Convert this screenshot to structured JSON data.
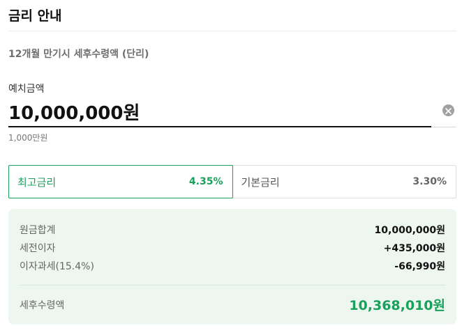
{
  "header": {
    "title": "금리 안내",
    "subtitle": "12개월 만기시 세후수령액 (단리)"
  },
  "deposit": {
    "label": "예치금액",
    "value": "10,000,000원",
    "helper": "1,000만원",
    "clear_icon": "clear-icon"
  },
  "rates": [
    {
      "name": "최고금리",
      "value": "4.35%",
      "selected": true
    },
    {
      "name": "기본금리",
      "value": "3.30%",
      "selected": false
    }
  ],
  "summary": {
    "rows": [
      {
        "label": "원금합계",
        "value": "10,000,000원"
      },
      {
        "label": "세전이자",
        "value": "+435,000원"
      },
      {
        "label": "이자과세(15.4%)",
        "value": "-66,990원"
      }
    ],
    "total": {
      "label": "세후수령액",
      "value": "10,368,010원"
    }
  },
  "colors": {
    "accent": "#19a05b",
    "summary_bg": "#eef6f0"
  }
}
